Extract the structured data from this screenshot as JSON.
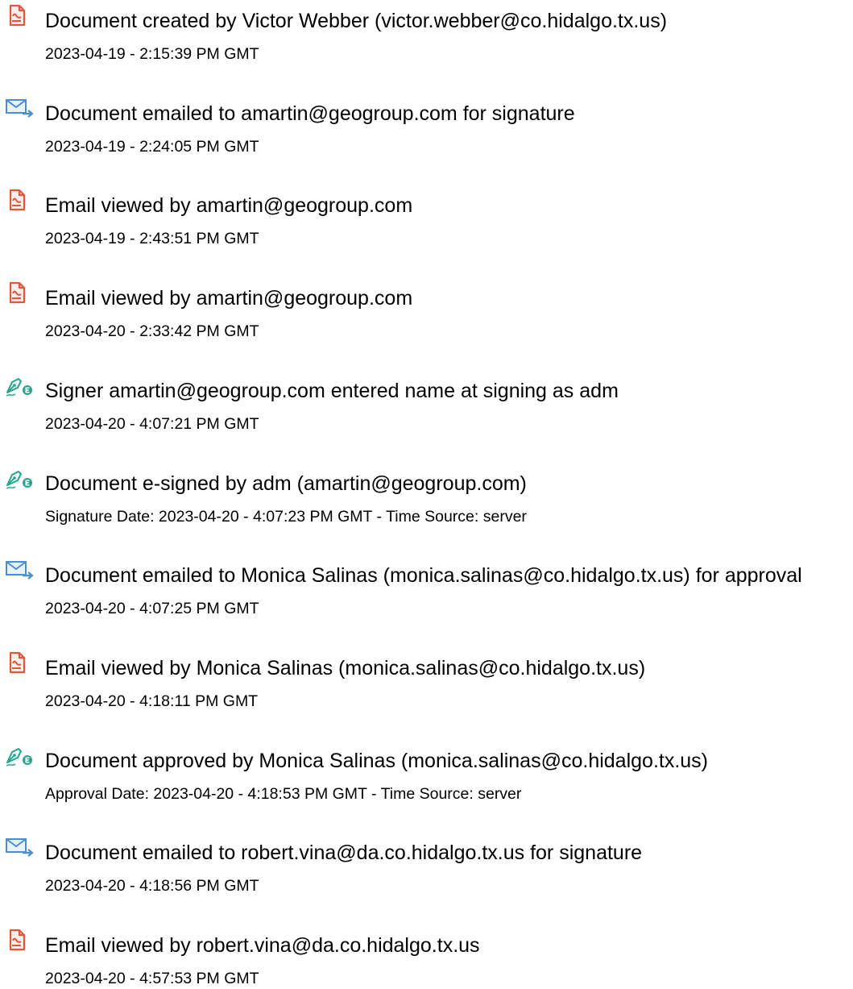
{
  "audit_events": [
    {
      "icon": "document-created-icon",
      "title": "Document created by Victor Webber (victor.webber@co.hidalgo.tx.us)",
      "detail": "2023-04-19 - 2:15:39 PM GMT"
    },
    {
      "icon": "email-sent-icon",
      "title": "Document emailed to amartin@geogroup.com for signature",
      "detail": "2023-04-19 - 2:24:05 PM GMT"
    },
    {
      "icon": "email-viewed-icon",
      "title": "Email viewed by amartin@geogroup.com",
      "detail": "2023-04-19 - 2:43:51 PM GMT"
    },
    {
      "icon": "email-viewed-icon",
      "title": "Email viewed by amartin@geogroup.com",
      "detail": "2023-04-20 - 2:33:42 PM GMT"
    },
    {
      "icon": "e-signature-pen-icon",
      "title": "Signer amartin@geogroup.com entered name at signing as adm",
      "detail": "2023-04-20 - 4:07:21 PM GMT"
    },
    {
      "icon": "e-signature-pen-icon",
      "title": "Document e-signed by adm (amartin@geogroup.com)",
      "detail": "Signature Date: 2023-04-20 - 4:07:23 PM GMT - Time Source: server"
    },
    {
      "icon": "email-sent-icon",
      "title": "Document emailed to Monica Salinas (monica.salinas@co.hidalgo.tx.us) for approval",
      "detail": "2023-04-20 - 4:07:25 PM GMT"
    },
    {
      "icon": "email-viewed-icon",
      "title": "Email viewed by Monica Salinas (monica.salinas@co.hidalgo.tx.us)",
      "detail": "2023-04-20 - 4:18:11 PM GMT"
    },
    {
      "icon": "e-signature-pen-icon",
      "title": "Document approved by Monica Salinas (monica.salinas@co.hidalgo.tx.us)",
      "detail": "Approval Date: 2023-04-20 - 4:18:53 PM GMT - Time Source: server"
    },
    {
      "icon": "email-sent-icon",
      "title": "Document emailed to robert.vina@da.co.hidalgo.tx.us for signature",
      "detail": "2023-04-20 - 4:18:56 PM GMT"
    },
    {
      "icon": "email-viewed-icon",
      "title": "Email viewed by robert.vina@da.co.hidalgo.tx.us",
      "detail": "2023-04-20 - 4:57:53 PM GMT"
    }
  ],
  "colors": {
    "document_icon": "#e0583a",
    "email_icon": "#4a8fd6",
    "signature_icon": "#2aa58c",
    "text": "#000000"
  }
}
